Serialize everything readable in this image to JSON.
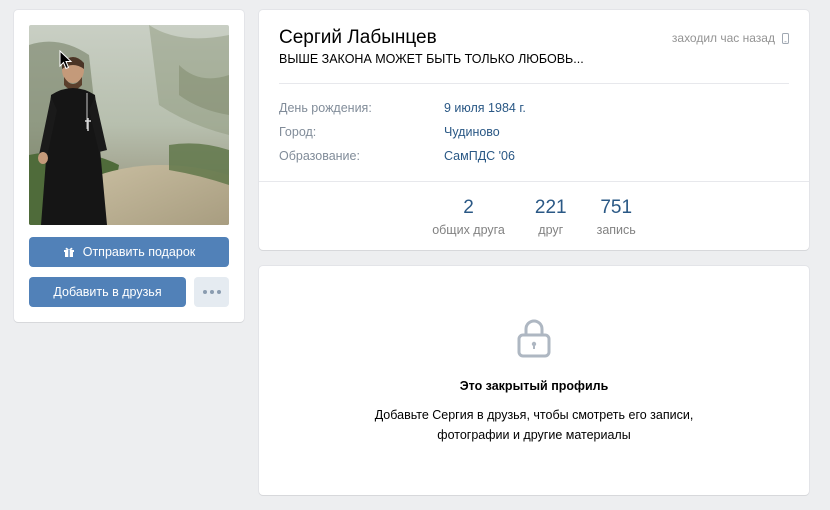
{
  "profile": {
    "name": "Сергий Лабынцев",
    "status": "ВЫШЕ ЗАКОНА МОЖЕТ БЫТЬ ТОЛЬКО ЛЮБОВЬ...",
    "last_seen": "заходил час назад",
    "last_seen_icon": "mobile-phone-icon"
  },
  "info": [
    {
      "label": "День рождения:",
      "value": "9 июля 1984 г."
    },
    {
      "label": "Город:",
      "value": "Чудиново"
    },
    {
      "label": "Образование:",
      "value": "СамПДС '06"
    }
  ],
  "counters": [
    {
      "value": "2",
      "label": "общих друга"
    },
    {
      "value": "221",
      "label": "друг"
    },
    {
      "value": "751",
      "label": "запись"
    }
  ],
  "actions": {
    "gift_label": "Отправить подарок",
    "gift_icon": "gift-icon",
    "add_friend_label": "Добавить в друзья",
    "more_icon": "more-dots-icon"
  },
  "closed_profile": {
    "icon": "lock-icon",
    "title": "Это закрытый профиль",
    "text_line1": "Добавьте Сергия в друзья, чтобы смотреть его записи,",
    "text_line2": "фотографии и другие материалы"
  },
  "colors": {
    "background": "#edeef0",
    "button": "#5181b8",
    "link": "#2a5885",
    "muted": "#818c99"
  }
}
